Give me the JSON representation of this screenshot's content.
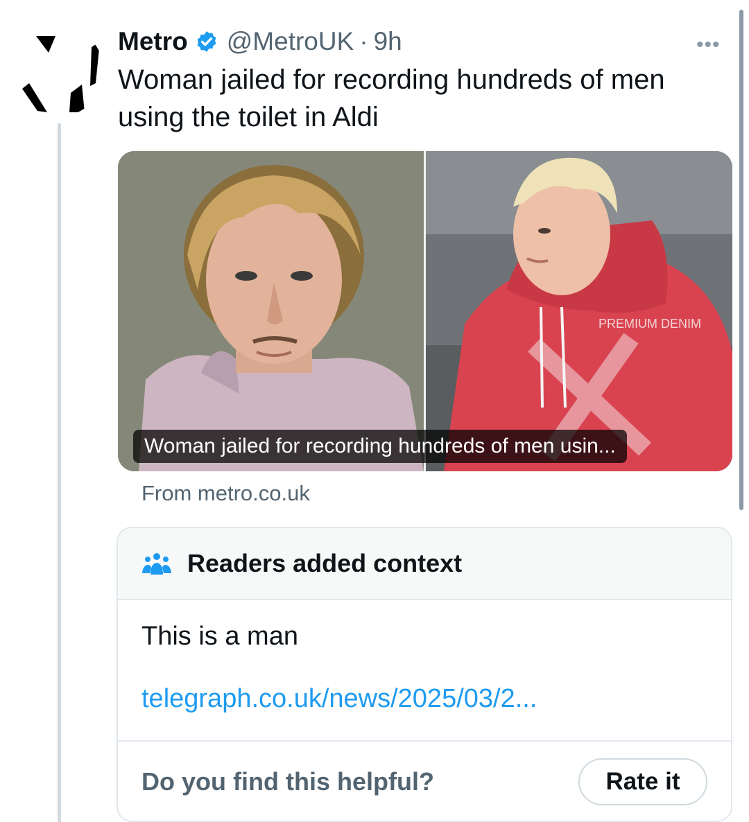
{
  "tweet": {
    "author_name": "Metro",
    "handle": "@MetroUK",
    "separator": "·",
    "time": "9h",
    "more_icon": "more-dots-icon",
    "text": "Woman jailed for recording hundreds of men using the toilet in Aldi",
    "accent_color": "#1d9bf0",
    "verified_icon": "verified-badge-icon"
  },
  "card": {
    "caption": "Woman jailed for recording hundreds of men usin...",
    "source": "From metro.co.uk",
    "hoodie_text": "PREMIUM DENIM"
  },
  "community_note": {
    "icon": "people-group-icon",
    "title": "Readers added context",
    "body": "This is a man",
    "link": "telegraph.co.uk/news/2025/03/2...",
    "helpful_prompt": "Do you find this helpful?",
    "rate_button": "Rate it"
  }
}
